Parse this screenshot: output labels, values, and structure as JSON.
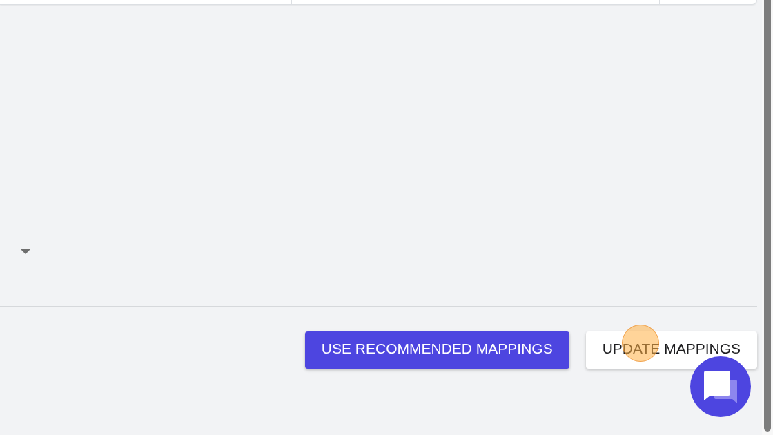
{
  "actions": [
    {
      "label": "USE RECOMMENDED MAPPINGS",
      "kind": "primary"
    },
    {
      "label": "UPDATE MAPPINGS",
      "kind": "secondary"
    }
  ]
}
